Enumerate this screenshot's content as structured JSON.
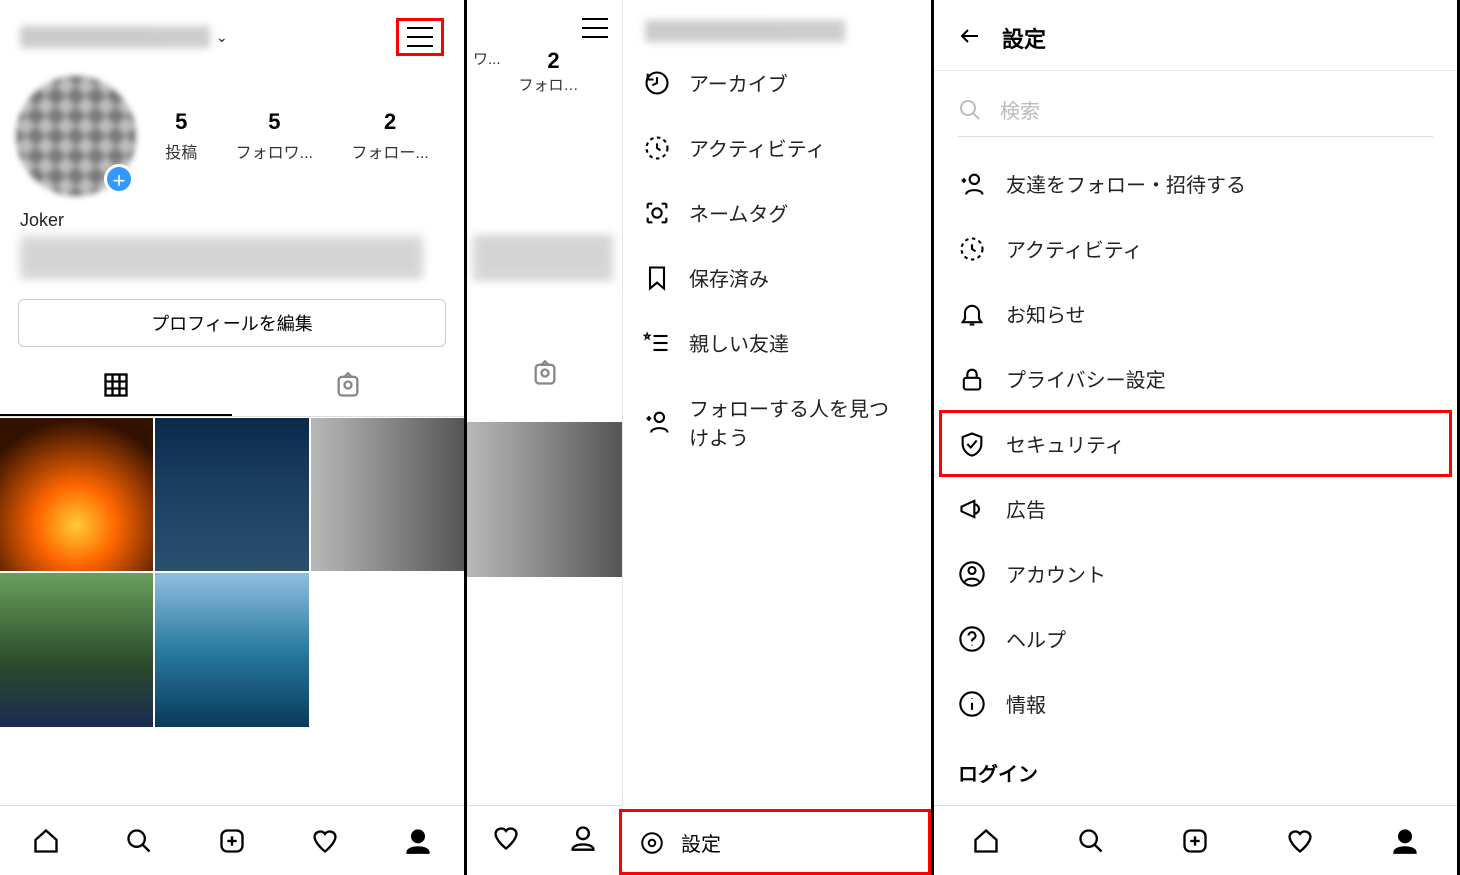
{
  "panel1": {
    "username_obscured": true,
    "stats": {
      "posts": {
        "count": "5",
        "label": "投稿"
      },
      "followers": {
        "count": "5",
        "label": "フォロワ..."
      },
      "following": {
        "count": "2",
        "label": "フォロー..."
      }
    },
    "bio_name": "Joker",
    "edit_button": "プロフィールを編集"
  },
  "panel2": {
    "username_obscured": true,
    "partial_stats": {
      "followers": {
        "count": "",
        "label": "ワ..."
      },
      "following": {
        "count": "2",
        "label": "フォロー..."
      }
    },
    "menu": {
      "archive": "アーカイブ",
      "activity": "アクティビティ",
      "nametag": "ネームタグ",
      "saved": "保存済み",
      "close_friends": "親しい友達",
      "discover": "フォローする人を見つけよう"
    },
    "settings_label": "設定"
  },
  "panel3": {
    "title": "設定",
    "search_placeholder": "検索",
    "items": {
      "follow_invite": "友達をフォロー・招待する",
      "activity": "アクティビティ",
      "notifications": "お知らせ",
      "privacy": "プライバシー設定",
      "security": "セキュリティ",
      "ads": "広告",
      "account": "アカウント",
      "help": "ヘルプ",
      "about": "情報"
    },
    "login_heading": "ログイン"
  }
}
